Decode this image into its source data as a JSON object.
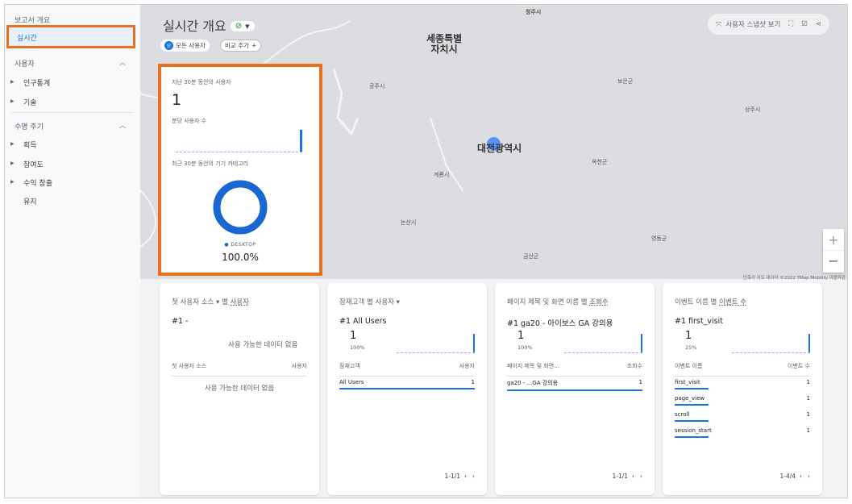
{
  "sidebar": {
    "overview": "보고서 개요",
    "realtime": "실시간",
    "user_section": "사용자",
    "demographics": "인구통계",
    "tech": "기술",
    "lifecycle_section": "수명 주기",
    "acquisition": "획득",
    "engagement": "참여도",
    "monetization": "수익 창출",
    "retention": "유지"
  },
  "header": {
    "title": "실시간 개요",
    "segment_badge": "모",
    "segment": "모든 사용자",
    "add_compare": "비교 추가",
    "toolbar_snapshot": "사용자 스냅샷 보기"
  },
  "map": {
    "labels": [
      "청주시",
      "공주시",
      "보은군",
      "상주시",
      "옥천군",
      "계룡시",
      "논산시",
      "영동군",
      "금산군"
    ],
    "big_labels": [
      "세종특별\n자치시",
      "대전광역시"
    ],
    "attribution": "단축키  지도 데이터 ©2022 TMap Mobility  이용약관"
  },
  "users_card": {
    "label": "지난 30분 동안의 사용자",
    "value": "1",
    "per_minute": "분당 사용자 수",
    "device_label": "최근 30분 동안의 기기 카테고리",
    "device": "DESKTOP",
    "device_pct": "100.0%",
    "device_fraction": 1.0,
    "accent": "#1967d2"
  },
  "cards": [
    {
      "title_a": "첫 사용자 소스",
      "title_b": " 별 ",
      "title_c": "사용자",
      "rank": "#1 -",
      "no_data": "사용 가능한 데이터 없음",
      "col1": "첫 사용자 소스",
      "col2": "사용자",
      "no_data2": "사용 가능한 데이터 없음"
    },
    {
      "title_a": "잠재고객",
      "title_b": " 별 ",
      "title_c": "사용자",
      "rank": "#1  All Users",
      "value": "1",
      "pct": "100%",
      "col1": "잠재고객",
      "col2": "사용자",
      "rows": [
        {
          "name": "All Users",
          "value": "1"
        }
      ],
      "pager": "1-1/1"
    },
    {
      "title_a": "페이지 제목 및 화면 이름",
      "title_b": " 별 ",
      "title_c": "조회수",
      "rank": "#1  ga20 - 아이보스 GA 강의용",
      "value": "1",
      "pct": "100%",
      "col1": "페이지 제목 및 화면...",
      "col2": "조회수",
      "rows": [
        {
          "name": "ga20 - ...GA 강의용",
          "value": "1"
        }
      ],
      "pager": "1-1/1"
    },
    {
      "title_a": "이벤트 이름",
      "title_b": " 별 ",
      "title_c": "이벤트 수",
      "rank": "#1  first_visit",
      "value": "1",
      "pct": "25%",
      "col1": "이벤트 이름",
      "col2": "이벤트 수",
      "rows": [
        {
          "name": "first_visit",
          "value": "1"
        },
        {
          "name": "page_view",
          "value": "1"
        },
        {
          "name": "scroll",
          "value": "1"
        },
        {
          "name": "session_start",
          "value": "1"
        }
      ],
      "pager": "1-4/4"
    }
  ]
}
